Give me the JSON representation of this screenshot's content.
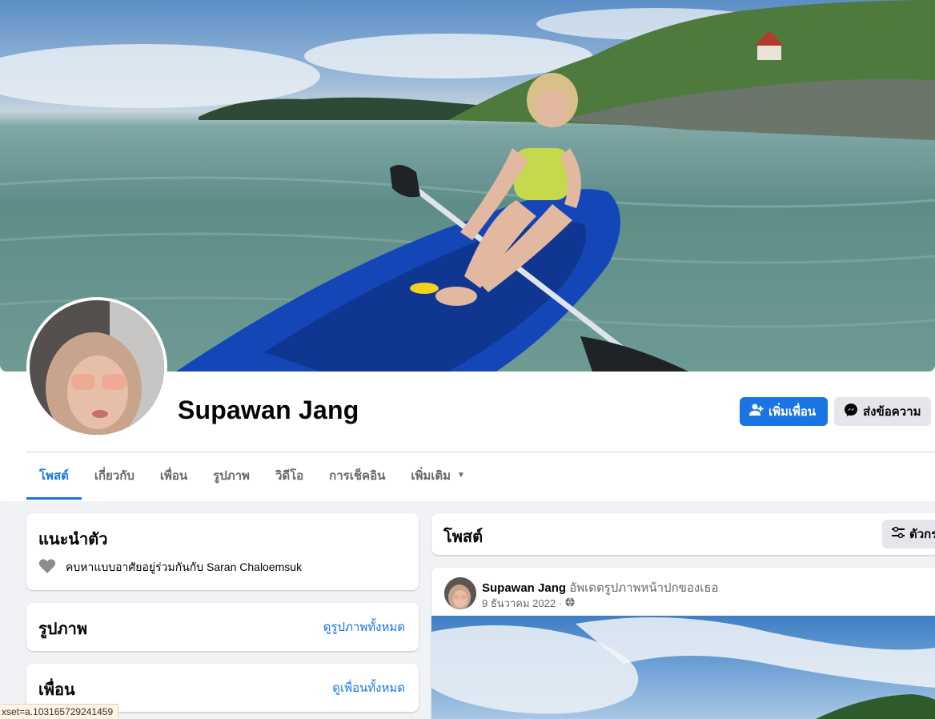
{
  "profile": {
    "name": "Supawan Jang",
    "add_friend_label": "เพิ่มเพื่อน",
    "message_label": "ส่งข้อความ"
  },
  "tabs": [
    {
      "label": "โพสต์",
      "active": true
    },
    {
      "label": "เกี่ยวกับ"
    },
    {
      "label": "เพื่อน"
    },
    {
      "label": "รูปภาพ"
    },
    {
      "label": "วิดีโอ"
    },
    {
      "label": "การเช็คอิน"
    },
    {
      "label": "เพิ่มเติม"
    }
  ],
  "intro": {
    "title": "แนะนำตัว",
    "relationship": "คบหาแบบอาศัยอยู่ร่วมกันกับ Saran Chaloemsuk"
  },
  "photos": {
    "title": "รูปภาพ",
    "link": "ดูรูปภาพทั้งหมด"
  },
  "friends": {
    "title": "เพื่อน",
    "link": "ดูเพื่อนทั้งหมด"
  },
  "posts_header": {
    "title": "โพสต์",
    "filter_label": "ตัวกร"
  },
  "post": {
    "author": "Supawan Jang",
    "action": "อัพเดตรูปภาพหน้าปกของเธอ",
    "date": "9 ธันวาคม 2022 ·"
  },
  "status_bar": {
    "text": "xset=a.103165729241459"
  },
  "colors": {
    "accent": "#1b74e4",
    "secondary_button": "#e4e6eb",
    "page_background": "#f0f2f5"
  }
}
